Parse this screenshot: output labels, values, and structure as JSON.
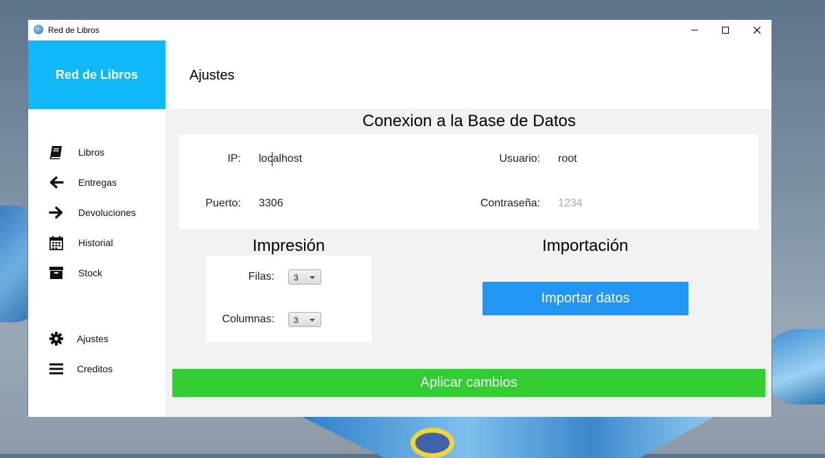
{
  "window": {
    "title": "Red de Libros"
  },
  "sidebar": {
    "brand": "Red de Libros",
    "items": [
      {
        "label": "Libros",
        "icon": "book-icon"
      },
      {
        "label": "Entregas",
        "icon": "arrow-left-icon"
      },
      {
        "label": "Devoluciones",
        "icon": "arrow-right-icon"
      },
      {
        "label": "Historial",
        "icon": "calendar-icon"
      },
      {
        "label": "Stock",
        "icon": "archive-box-icon"
      },
      {
        "label": "Ajustes",
        "icon": "gear-icon"
      },
      {
        "label": "Creditos",
        "icon": "menu-bars-icon"
      }
    ]
  },
  "header": {
    "title": "Ajustes"
  },
  "db": {
    "title": "Conexion a la Base de Datos",
    "ip_label": "IP:",
    "ip_value": "localhost",
    "port_label": "Puerto:",
    "port_value": "3306",
    "user_label": "Usuario:",
    "user_value": "root",
    "password_label": "Contraseña:",
    "password_placeholder": "1234"
  },
  "print": {
    "title": "Impresión",
    "rows_label": "Filas:",
    "rows_value": "3",
    "cols_label": "Columnas:",
    "cols_value": "3"
  },
  "import": {
    "title": "Importación",
    "button": "Importar datos"
  },
  "apply_button": "Aplicar cambios",
  "colors": {
    "brand": "#0fb9f7",
    "import_button": "#2196f3",
    "apply_button": "#33cc33"
  }
}
